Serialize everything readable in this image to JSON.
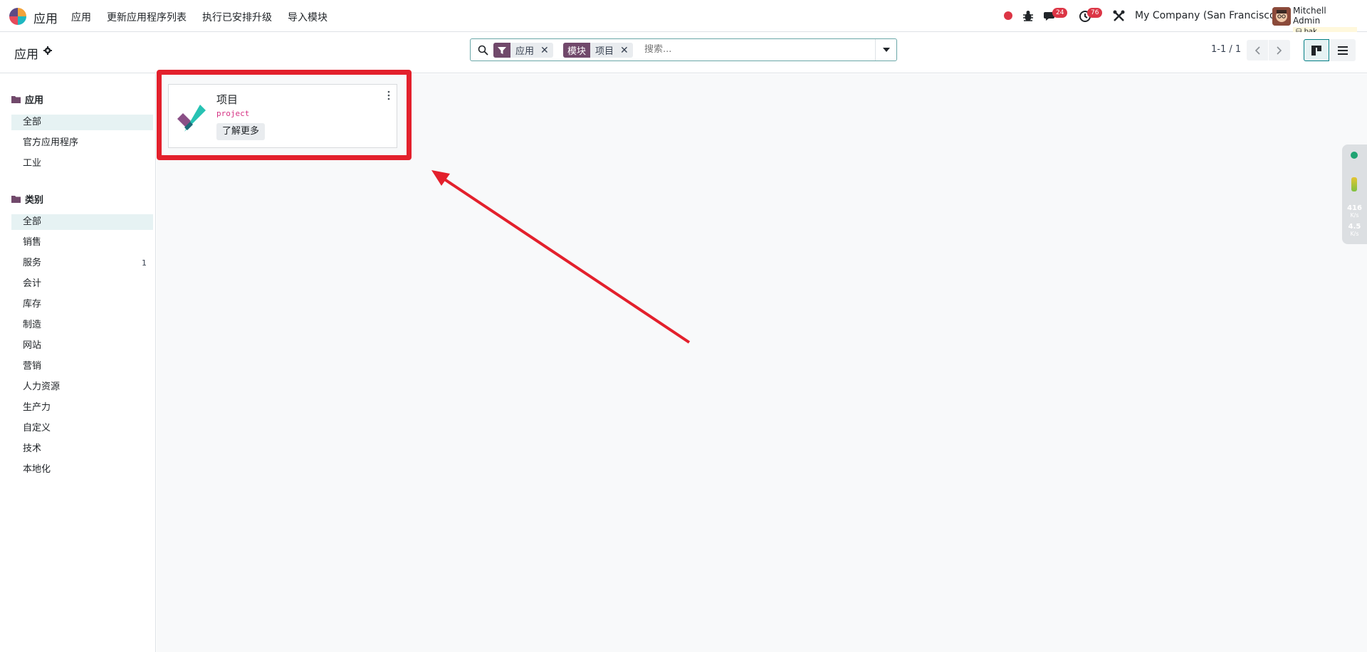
{
  "navbar": {
    "brand": "应用",
    "menu": [
      "应用",
      "更新应用程序列表",
      "执行已安排升级",
      "导入模块"
    ],
    "chat_count": "24",
    "activity_count": "76",
    "company": "My Company (San Francisco)",
    "user_name": "Mitchell Admin",
    "db_name": "bak"
  },
  "control": {
    "breadcrumb": "应用",
    "facets": [
      {
        "tag": "",
        "value": "应用"
      },
      {
        "tag": "模块",
        "value": "项目"
      }
    ],
    "search_placeholder": "搜索...",
    "pager": "1-1 / 1"
  },
  "sidebar": {
    "apps_header": "应用",
    "apps_items": [
      "全部",
      "官方应用程序",
      "工业"
    ],
    "categories_header": "类别",
    "category_items": [
      {
        "label": "全部",
        "count": ""
      },
      {
        "label": "销售",
        "count": ""
      },
      {
        "label": "服务",
        "count": "1"
      },
      {
        "label": "会计",
        "count": ""
      },
      {
        "label": "库存",
        "count": ""
      },
      {
        "label": "制造",
        "count": ""
      },
      {
        "label": "网站",
        "count": ""
      },
      {
        "label": "营销",
        "count": ""
      },
      {
        "label": "人力资源",
        "count": ""
      },
      {
        "label": "生产力",
        "count": ""
      },
      {
        "label": "自定义",
        "count": ""
      },
      {
        "label": "技术",
        "count": ""
      },
      {
        "label": "本地化",
        "count": ""
      }
    ]
  },
  "card": {
    "title": "项目",
    "technical_name": "project",
    "learn_more": "了解更多"
  },
  "network_widget": {
    "upload_value": "416",
    "upload_unit": "K/s",
    "download_value": "4.5",
    "download_unit": "K/s"
  },
  "colors": {
    "accent": "#71496b",
    "highlight": "#e3202c",
    "primary": "#017e84"
  }
}
